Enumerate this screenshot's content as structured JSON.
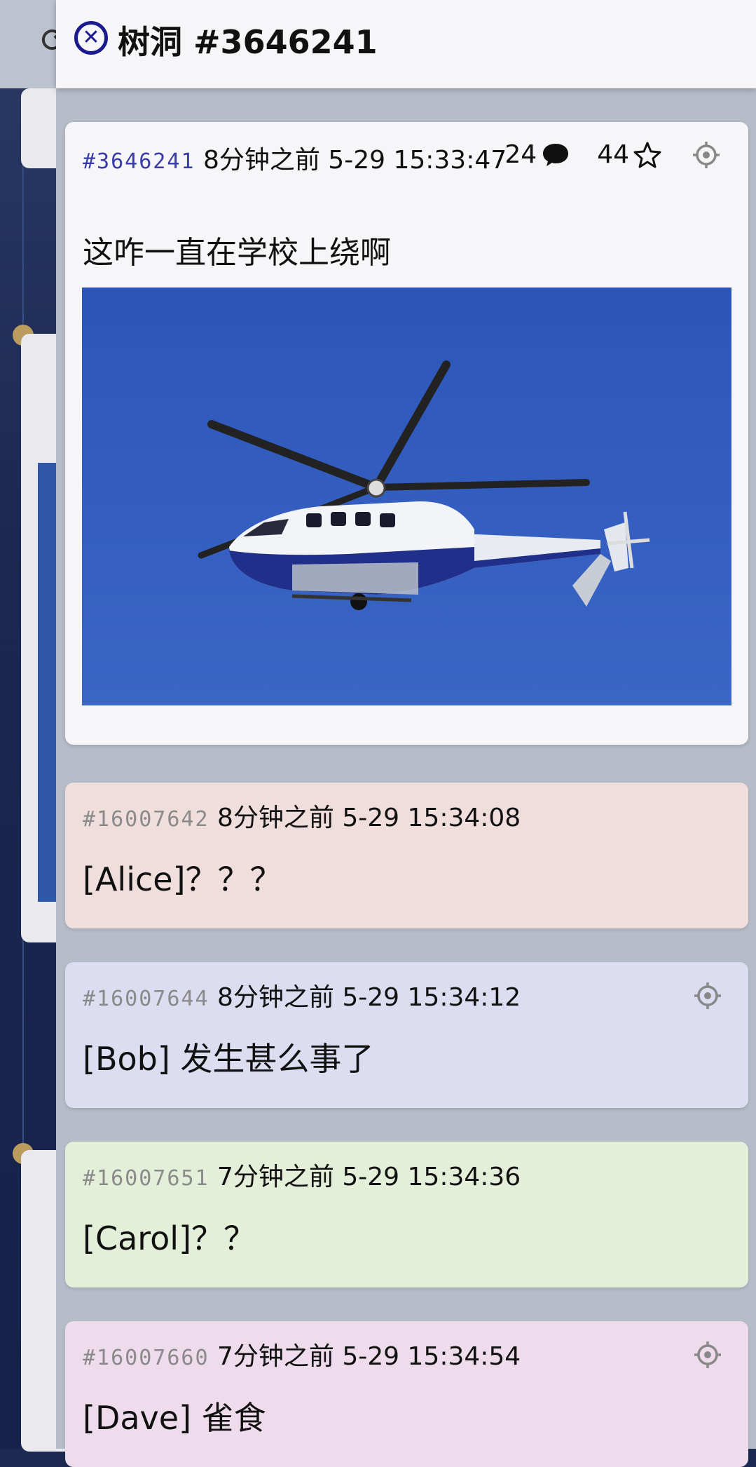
{
  "header": {
    "title": "树洞 #3646241"
  },
  "post": {
    "id": "#3646241",
    "time": "8分钟之前 5-29 15:33:47",
    "reply_count": "24",
    "star_count": "44",
    "text": "这咋一直在学校上绕啊",
    "image_icon": "helicopter-photo"
  },
  "replies": [
    {
      "id": "#16007642",
      "time": "8分钟之前 5-29 15:34:08",
      "text": "[Alice]？？？",
      "color": "#efdedb"
    },
    {
      "id": "#16007644",
      "time": "8分钟之前 5-29 15:34:12",
      "text": "[Bob] 发生甚么事了",
      "color": "#dcddf0"
    },
    {
      "id": "#16007651",
      "time": "7分钟之前 5-29 15:34:36",
      "text": "[Carol]？？",
      "color": "#e4efda"
    },
    {
      "id": "#16007660",
      "time": "7分钟之前 5-29 15:34:54",
      "text": "[Dave] 雀食",
      "color": "#eedcec"
    }
  ],
  "colors": {
    "accent": "#1b1b8f",
    "id_color": "#3b3ba8",
    "sky": "#2f5bbd"
  }
}
